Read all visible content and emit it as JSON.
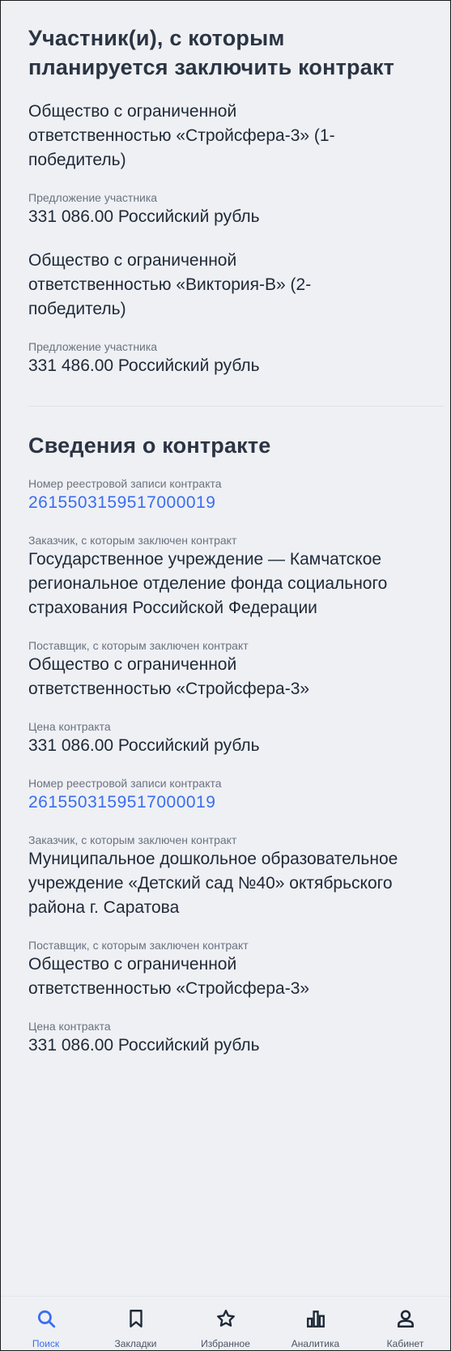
{
  "participants": {
    "title": "Участник(и), с которым планируется заключить контракт",
    "items": [
      {
        "name": "Общество с ограниченной ответственностью «Стройсфера-3» (1-победитель)",
        "offer_label": "Предложение участника",
        "offer_value": "331 086.00 Российский рубль"
      },
      {
        "name": "Общество с ограниченной ответственностью «Виктория-В» (2-победитель)",
        "offer_label": "Предложение участника",
        "offer_value": "331 486.00 Российский рубль"
      }
    ]
  },
  "contract": {
    "title": "Сведения о контракте",
    "entries": [
      {
        "reg_label": "Номер реестровой записи контракта",
        "reg_number": "2615503159517000019",
        "customer_label": "Заказчик, с которым заключен контракт",
        "customer": "Государственное учреждение — Камчатское региональное отделение фонда социального страхования Российской Федерации",
        "supplier_label": "Поставщик, с которым заключен контракт",
        "supplier": "Общество с ограниченной ответственностью «Стройсфера-3»",
        "price_label": "Цена контракта",
        "price": "331 086.00 Российский рубль"
      },
      {
        "reg_label": "Номер реестровой записи контракта",
        "reg_number": "2615503159517000019",
        "customer_label": "Заказчик, с которым заключен контракт",
        "customer": "Муниципальное дошкольное образовательное учреждение «Детский сад №40» октябрьского района г. Саратова",
        "supplier_label": "Поставщик, с которым заключен контракт",
        "supplier": "Общество с ограниченной ответственностью «Стройсфера-3»",
        "price_label": "Цена контракта",
        "price": "331 086.00 Российский рубль"
      }
    ]
  },
  "tabbar": {
    "items": [
      {
        "label": "Поиск",
        "icon": "search-icon",
        "active": true
      },
      {
        "label": "Закладки",
        "icon": "bookmark-icon",
        "active": false
      },
      {
        "label": "Избранное",
        "icon": "star-icon",
        "active": false
      },
      {
        "label": "Аналитика",
        "icon": "analytics-icon",
        "active": false
      },
      {
        "label": "Кабинет",
        "icon": "user-icon",
        "active": false
      }
    ],
    "active_color": "#3a6df0"
  }
}
